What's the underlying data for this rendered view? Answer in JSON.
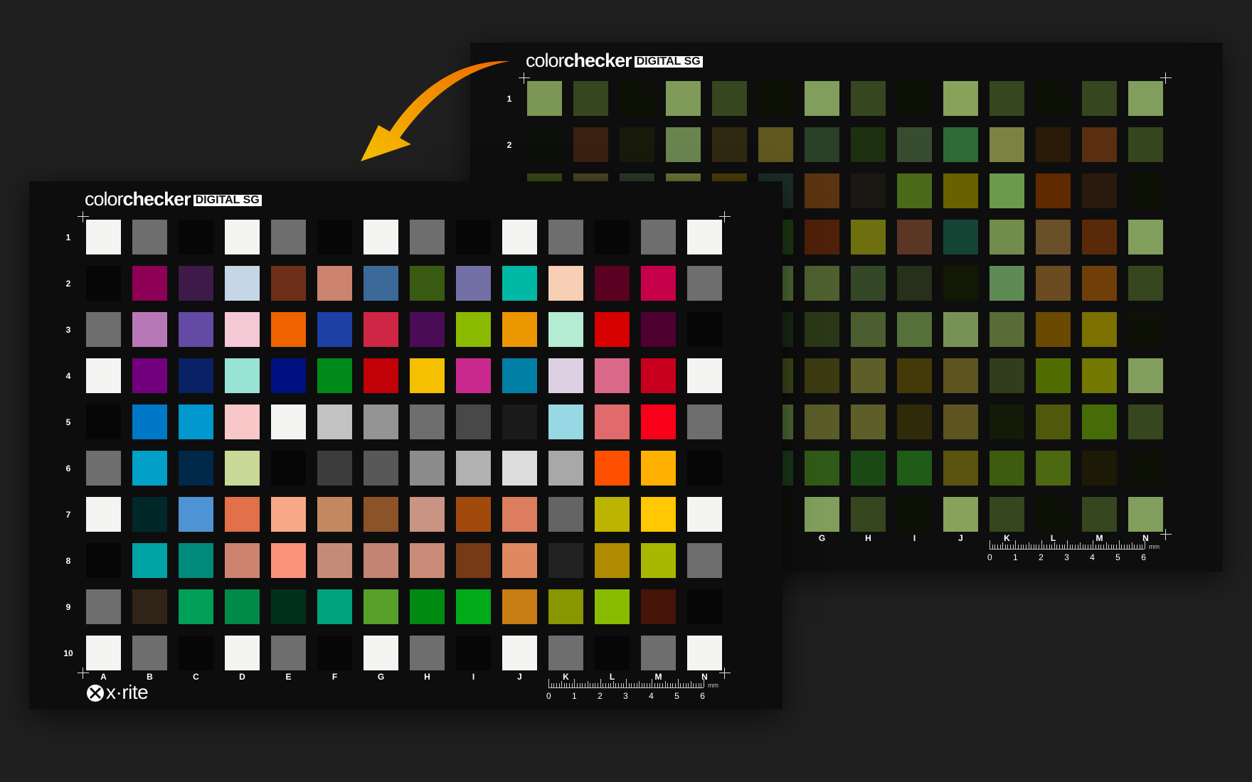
{
  "brand": {
    "part1": "color",
    "part2": "checker",
    "badge": "DIGITAL SG"
  },
  "logo": {
    "text": "x·rite"
  },
  "ruler": {
    "unit": "mm",
    "numbers": [
      "0",
      "1",
      "2",
      "3",
      "4",
      "5",
      "6"
    ]
  },
  "rows": [
    "1",
    "2",
    "3",
    "4",
    "5",
    "6",
    "7",
    "8",
    "9",
    "10"
  ],
  "columns": [
    "A",
    "B",
    "C",
    "D",
    "E",
    "F",
    "G",
    "H",
    "I",
    "J",
    "K",
    "L",
    "M",
    "N"
  ],
  "back_row_labels": [
    "1",
    "2"
  ],
  "back_column_labels": [
    "G",
    "H",
    "I",
    "J",
    "K",
    "L",
    "M",
    "N"
  ],
  "front_colors": [
    [
      "#f4f4f2",
      "#6e6e6e",
      "#060606",
      "#f4f4f2",
      "#6e6e6e",
      "#060606",
      "#f4f4f2",
      "#6e6e6e",
      "#060606",
      "#f4f4f2",
      "#6e6e6e",
      "#060606",
      "#6e6e6e",
      "#f4f4f2"
    ],
    [
      "#060606",
      "#8e0055",
      "#3e1a48",
      "#c5d6e6",
      "#6e2e1a",
      "#cc8470",
      "#3b6a98",
      "#385a12",
      "#7370a8",
      "#00b9a5",
      "#f8ceb4",
      "#5a0020",
      "#c7004a",
      "#6e6e6e"
    ],
    [
      "#6e6e6e",
      "#b878b8",
      "#644aa4",
      "#f5c8d6",
      "#ef6300",
      "#1c40a4",
      "#cf2646",
      "#4a0c56",
      "#8cba00",
      "#ec9700",
      "#b4ecd4",
      "#d70000",
      "#4e0030",
      "#060606"
    ],
    [
      "#f4f4f2",
      "#72007e",
      "#082064",
      "#98e2d6",
      "#001080",
      "#008a1a",
      "#c20008",
      "#f4c000",
      "#ca2a8e",
      "#0080a6",
      "#dcd0e2",
      "#da6888",
      "#c8001e",
      "#f4f4f2"
    ],
    [
      "#060606",
      "#0078c8",
      "#0098ce",
      "#f8c8c8",
      "#f4f4f2",
      "#c2c2c2",
      "#949494",
      "#6e6e6e",
      "#484848",
      "#1a1a1a",
      "#98d8e4",
      "#e06a6c",
      "#f8001a",
      "#6e6e6e"
    ],
    [
      "#6e6e6e",
      "#00a0c8",
      "#002848",
      "#c8d998",
      "#060606",
      "#3c3c3c",
      "#585858",
      "#8c8c8c",
      "#b2b2b2",
      "#dcdcdc",
      "#a8a8a8",
      "#ff5000",
      "#ffb000",
      "#060606"
    ],
    [
      "#f4f4f2",
      "#002828",
      "#4e94d4",
      "#e27048",
      "#f6a888",
      "#c48860",
      "#8c5228",
      "#ca9484",
      "#a24a0c",
      "#dc7e5e",
      "#646464",
      "#bcb400",
      "#ffc800",
      "#f4f4f2"
    ],
    [
      "#060606",
      "#00a4a4",
      "#008a7c",
      "#cc8470",
      "#fc927c",
      "#c48c78",
      "#c48474",
      "#ca8a78",
      "#763a16",
      "#e08860",
      "#222222",
      "#b08a00",
      "#a8b800",
      "#6e6e6e"
    ],
    [
      "#6e6e6e",
      "#302418",
      "#00a05a",
      "#008a48",
      "#003018",
      "#00a47c",
      "#56a02a",
      "#008a12",
      "#00aa18",
      "#c87e14",
      "#8a9600",
      "#88bc00",
      "#461408",
      "#060606"
    ],
    [
      "#f4f4f2",
      "#6e6e6e",
      "#060606",
      "#f4f4f2",
      "#6e6e6e",
      "#060606",
      "#f4f4f2",
      "#6e6e6e",
      "#060606",
      "#f4f4f2",
      "#6e6e6e",
      "#060606",
      "#6e6e6e",
      "#f4f4f2"
    ]
  ],
  "back_colors": [
    [
      "#7b9655",
      "#36461f",
      "#0e1206",
      "#809a5a",
      "#36461f",
      "#0e1206",
      "#819e5c",
      "#36461f",
      "#0e1206",
      "#88a25c",
      "#36461f",
      "#0e1206",
      "#36461f",
      "#819e5c"
    ],
    [
      "#0c1006",
      "#3a2010",
      "#181a0c",
      "#6a8450",
      "#302810",
      "#605820",
      "#2a4028",
      "#1c3010",
      "#384c30",
      "#2e6a38",
      "#7a8440",
      "#2a1a08",
      "#5a2e10",
      "#34461e"
    ],
    [
      "#3a4a18",
      "#4e4624",
      "#2a3c26",
      "#6e7a36",
      "#4e3e08",
      "#1c2e26",
      "#5a3410",
      "#1a1812",
      "#4a6a1a",
      "#6a6000",
      "#6a9a4c",
      "#602a00",
      "#281a0e",
      "#0e1206"
    ],
    [
      "#2a3a14",
      "#3a4010",
      "#1e2a10",
      "#566828",
      "#4a3e10",
      "#1e3a14",
      "#4e2008",
      "#6e7010",
      "#5c3624",
      "#144434",
      "#728c4c",
      "#6a5028",
      "#5a2a08",
      "#819e5c"
    ],
    [
      "#36461f",
      "#4a4a20",
      "#223418",
      "#6e8440",
      "#3e3a12",
      "#4e6e38",
      "#4e6030",
      "#344828",
      "#26301a",
      "#121806",
      "#5e8a56",
      "#6a4c20",
      "#703e08",
      "#36461f"
    ],
    [
      "#0e1206",
      "#2a2a10",
      "#1a2410",
      "#5a6628",
      "#3e4010",
      "#1a2a14",
      "#2a3818",
      "#4a5e30",
      "#56703a",
      "#789256",
      "#586c38",
      "#6a4a00",
      "#7c7000",
      "#0e1206"
    ],
    [
      "#819e5c",
      "#3a3a10",
      "#121a0a",
      "#5e6a28",
      "#4e4a14",
      "#3e4a18",
      "#3c3a10",
      "#5e5e28",
      "#443a08",
      "#5e5420",
      "#303e1e",
      "#506c00",
      "#727800",
      "#819e5c"
    ],
    [
      "#36461f",
      "#4a4a20",
      "#223418",
      "#6e8440",
      "#3e3a12",
      "#4e6e38",
      "#5a5c28",
      "#5e5e28",
      "#302a08",
      "#5e5420",
      "#141a08",
      "#50580c",
      "#466c08",
      "#36461f"
    ],
    [
      "#0e1206",
      "#2a2a10",
      "#1a2410",
      "#5a6628",
      "#3e4010",
      "#1a3a18",
      "#305a18",
      "#1a4a14",
      "#1e5c18",
      "#5a5410",
      "#3e5c10",
      "#4c6810",
      "#1c1a04",
      "#0e1206"
    ],
    [
      "#819e5c",
      "#36461f",
      "#0e1206",
      "#809a5a",
      "#36461f",
      "#0e1206",
      "#819e5c",
      "#36461f",
      "#0e1206",
      "#88a25c",
      "#36461f",
      "#0e1206",
      "#36461f",
      "#819e5c"
    ]
  ]
}
